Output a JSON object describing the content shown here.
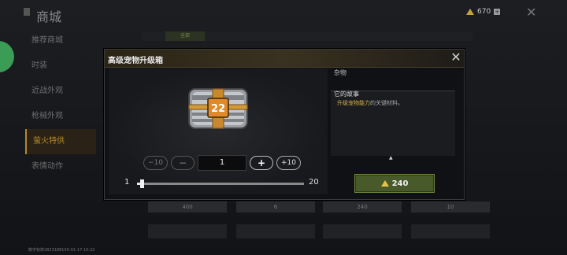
{
  "background": {
    "shop_title": "商城",
    "side_menu": [
      "推荐商城",
      "时装",
      "近战外观",
      "枪械外观",
      "萤火特供",
      "表情动作"
    ],
    "currency_amount": "670",
    "tab_label": "全部",
    "price_row": [
      "400",
      "6",
      "240",
      "10"
    ],
    "footnote": "数字标样2823188150-01-17-10:22"
  },
  "modal": {
    "title": "高级宠物升级箱",
    "close_symbol": "✕",
    "item_badge": "22",
    "category": "杂物",
    "story_heading": "它的故事",
    "story_highlight": "升级宠物能力",
    "story_rest": "的关键材料。",
    "scroll_symbol": "▲",
    "quantity": {
      "minus10_label": "−10",
      "minus_label": "−",
      "value": "1",
      "plus_label": "+",
      "plus10_label": "+10"
    },
    "slider": {
      "min_label": "1",
      "max_label": "20",
      "value": 1,
      "min": 1,
      "max": 20
    },
    "buy": {
      "price": "240",
      "currency_icon": "triangle-coin-icon"
    }
  },
  "colors": {
    "accent_gold": "#d6b04a",
    "buy_green": "#485a2a"
  }
}
